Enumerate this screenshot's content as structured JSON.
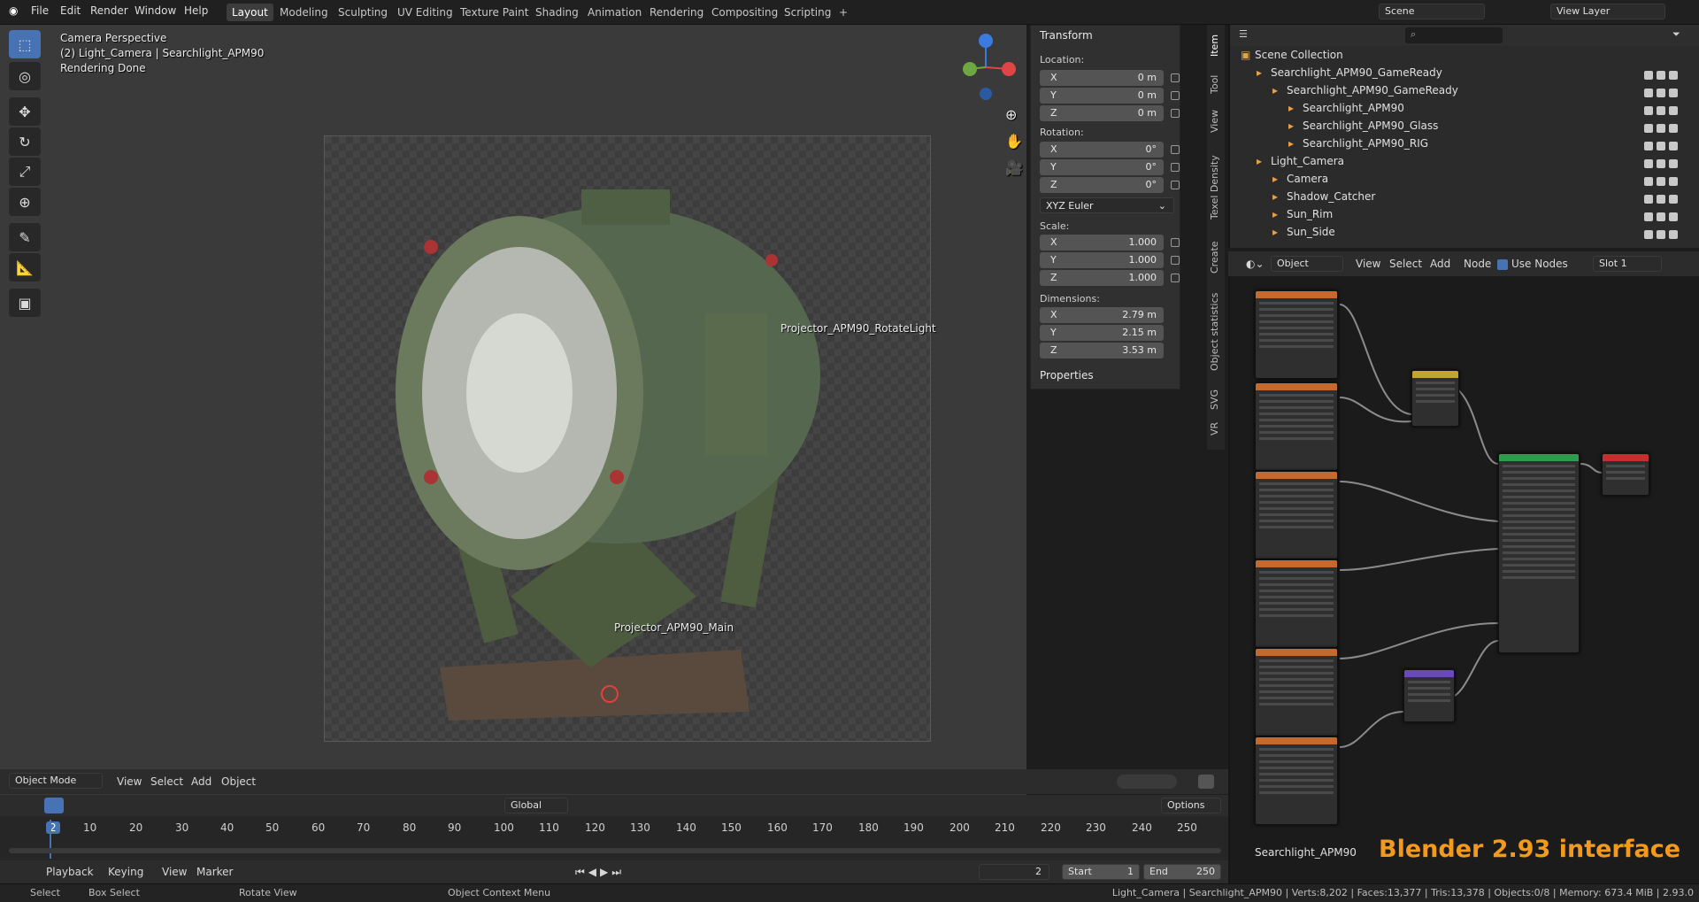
{
  "menubar": {
    "items": [
      "File",
      "Edit",
      "Render",
      "Window",
      "Help"
    ],
    "workspaces": [
      "Layout",
      "Modeling",
      "Sculpting",
      "UV Editing",
      "Texture Paint",
      "Shading",
      "Animation",
      "Rendering",
      "Compositing",
      "Scripting"
    ],
    "scene": "Scene",
    "view_layer": "View Layer"
  },
  "viewport": {
    "overlay_line1": "Camera Perspective",
    "overlay_line2": "(2) Light_Camera | Searchlight_APM90",
    "overlay_line3": "Rendering Done",
    "label_rotate": "Projector_APM90_RotateLight",
    "label_main": "Projector_APM90_Main",
    "header": {
      "mode": "Object Mode",
      "view": "View",
      "select": "Select",
      "add": "Add",
      "object": "Object"
    }
  },
  "transform": {
    "title": "Transform",
    "location_label": "Location:",
    "rotation_label": "Rotation:",
    "scale_label": "Scale:",
    "dimensions_label": "Dimensions:",
    "loc": [
      {
        "axis": "X",
        "value": "0 m"
      },
      {
        "axis": "Y",
        "value": "0 m"
      },
      {
        "axis": "Z",
        "value": "0 m"
      }
    ],
    "rot": [
      {
        "axis": "X",
        "value": "0°"
      },
      {
        "axis": "Y",
        "value": "0°"
      },
      {
        "axis": "Z",
        "value": "0°"
      }
    ],
    "rot_mode": "XYZ Euler",
    "scale": [
      {
        "axis": "X",
        "value": "1.000"
      },
      {
        "axis": "Y",
        "value": "1.000"
      },
      {
        "axis": "Z",
        "value": "1.000"
      }
    ],
    "dims": [
      {
        "axis": "X",
        "value": "2.79 m"
      },
      {
        "axis": "Y",
        "value": "2.15 m"
      },
      {
        "axis": "Z",
        "value": "3.53 m"
      }
    ],
    "properties": "Properties"
  },
  "side_tabs": [
    "Item",
    "Tool",
    "View",
    "Texel Density",
    "Create",
    "Object statistics",
    "SVG",
    "VR"
  ],
  "outliner": {
    "rows": [
      {
        "name": "Scene Collection",
        "indent": 0
      },
      {
        "name": "Searchlight_APM90_GameReady",
        "indent": 1
      },
      {
        "name": "Searchlight_APM90_GameReady",
        "indent": 2
      },
      {
        "name": "Searchlight_APM90",
        "indent": 3
      },
      {
        "name": "Searchlight_APM90_Glass",
        "indent": 3
      },
      {
        "name": "Searchlight_APM90_RIG",
        "indent": 3
      },
      {
        "name": "Light_Camera",
        "indent": 1
      },
      {
        "name": "Camera",
        "indent": 2
      },
      {
        "name": "Shadow_Catcher",
        "indent": 2
      },
      {
        "name": "Sun_Rim",
        "indent": 2
      },
      {
        "name": "Sun_Side",
        "indent": 2
      }
    ]
  },
  "node_editor": {
    "object": "Object",
    "view": "View",
    "select": "Select",
    "add": "Add",
    "node": "Node",
    "use_nodes": "Use Nodes",
    "slot": "Slot 1",
    "material_name": "Searchlight_APM90",
    "watermark": "Blender 2.93 interface"
  },
  "toolbar2": {
    "orientation": "Global",
    "options": "Options"
  },
  "timeline": {
    "ticks": [
      "2",
      "10",
      "20",
      "30",
      "40",
      "50",
      "60",
      "70",
      "80",
      "90",
      "100",
      "110",
      "120",
      "130",
      "140",
      "150",
      "160",
      "170",
      "180",
      "190",
      "200",
      "210",
      "220",
      "230",
      "240",
      "250"
    ],
    "playback": "Playback",
    "keying": "Keying",
    "view": "View",
    "marker": "Marker",
    "current": "2",
    "start_label": "Start",
    "start": "1",
    "end_label": "End",
    "end": "250"
  },
  "status": {
    "select": "Select",
    "box_select": "Box Select",
    "rotate_view": "Rotate View",
    "context_menu": "Object Context Menu",
    "stats": "Light_Camera | Searchlight_APM90 | Verts:8,202 | Faces:13,377 | Tris:13,378 | Objects:0/8 | Memory: 673.4 MiB | 2.93.0"
  }
}
